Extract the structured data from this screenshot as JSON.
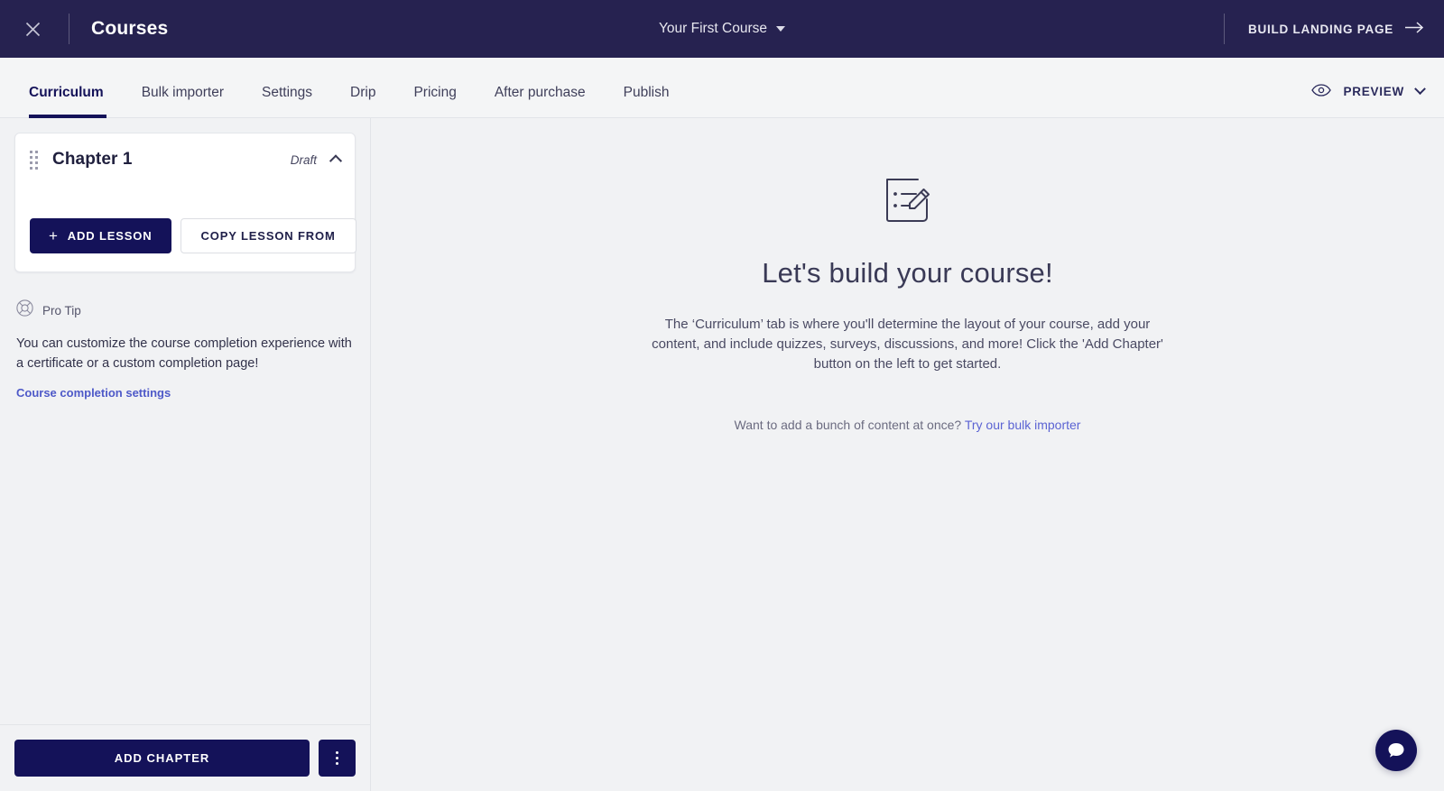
{
  "topbar": {
    "close_icon": "close-icon",
    "brand": "Courses",
    "course_name": "Your First Course",
    "course_caret_icon": "caret-down-icon",
    "build_landing_page": "BUILD LANDING PAGE",
    "build_landing_arrow_icon": "arrow-right-icon",
    "bg_color": "#262250"
  },
  "tabs": [
    {
      "label": "Curriculum",
      "active": true
    },
    {
      "label": "Bulk importer",
      "active": false
    },
    {
      "label": "Settings",
      "active": false
    },
    {
      "label": "Drip",
      "active": false
    },
    {
      "label": "Pricing",
      "active": false
    },
    {
      "label": "After purchase",
      "active": false
    },
    {
      "label": "Publish",
      "active": false
    }
  ],
  "preview": {
    "label": "PREVIEW",
    "eye_icon": "eye-icon",
    "chevron_icon": "chevron-down-icon"
  },
  "sidebar": {
    "chapter": {
      "drag_icon": "drag-handle-icon",
      "title": "Chapter 1",
      "status": "Draft",
      "collapse_icon": "chevron-up-icon",
      "add_lesson_label": "ADD LESSON",
      "add_lesson_plus": "+",
      "copy_lesson_label": "COPY LESSON FROM"
    },
    "protip": {
      "icon": "lifebuoy-icon",
      "label": "Pro Tip",
      "body": "You can customize the course completion experience with a certificate or a custom completion page!",
      "link": "Course completion settings"
    },
    "footer": {
      "add_chapter_label": "ADD CHAPTER",
      "kebab_icon": "more-vertical-icon"
    }
  },
  "main": {
    "icon": "note-pencil-icon",
    "title": "Let's build your course!",
    "description": "The ‘Curriculum’ tab is where you'll determine the layout of your course, add your content, and include quizzes, surveys, discussions, and more! Click the 'Add Chapter' button on the left to get started.",
    "sub_prompt": "Want to add a bunch of content at once? ",
    "sub_link": "Try our bulk importer"
  },
  "chat": {
    "icon": "chat-bubble-icon",
    "bg_color": "#141259"
  },
  "colors": {
    "navy_bar": "#262250",
    "navy_button": "#141259",
    "page_bg": "#f1f2f4",
    "link": "#5b63d3"
  }
}
